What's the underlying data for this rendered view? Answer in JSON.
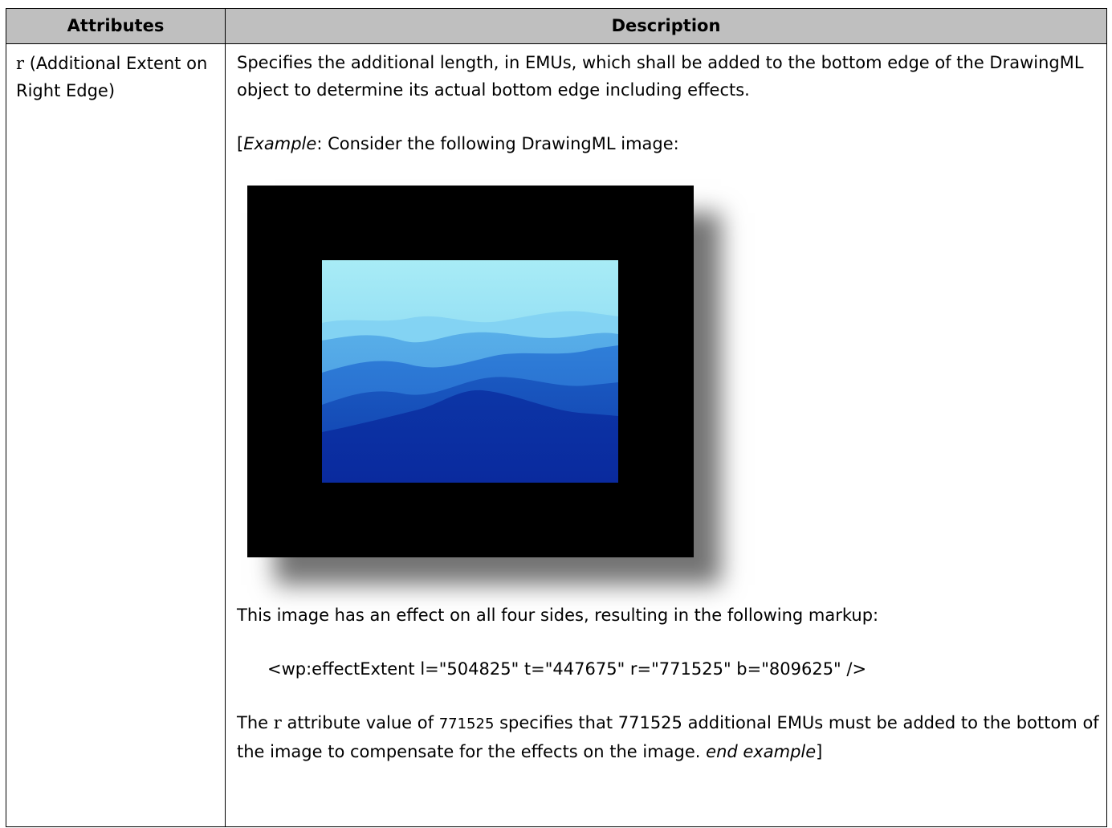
{
  "table": {
    "headers": [
      "Attributes",
      "Description"
    ],
    "attribute": {
      "name": "r",
      "label": "(Additional Extent on Right Edge)"
    },
    "description": {
      "paragraph1": "Specifies the additional length, in EMUs, which shall be added to the bottom edge of the DrawingML object to determine its actual bottom edge including effects.",
      "example_open": "[",
      "example_word": "Example",
      "example_intro": ": Consider the following DrawingML image:",
      "paragraph3": "This image has an effect on all four sides, resulting in the following markup:",
      "code": "<wp:effectExtent l=\"504825\" t=\"447675\" r=\"771525\" b=\"809625\" />",
      "final_prefix": "The ",
      "final_attr": "r",
      "final_mid1": " attribute value of ",
      "final_value": "771525",
      "final_mid2": " specifies that 771525 additional EMUs must be added to the bottom of the image to compensate for the effects on the image. ",
      "final_end": "end example",
      "final_close": "]"
    }
  },
  "figure": {
    "frame_color": "#000000",
    "sky_color": "#a8ecf6",
    "mountain_dark_color": "#0a2a9e"
  }
}
